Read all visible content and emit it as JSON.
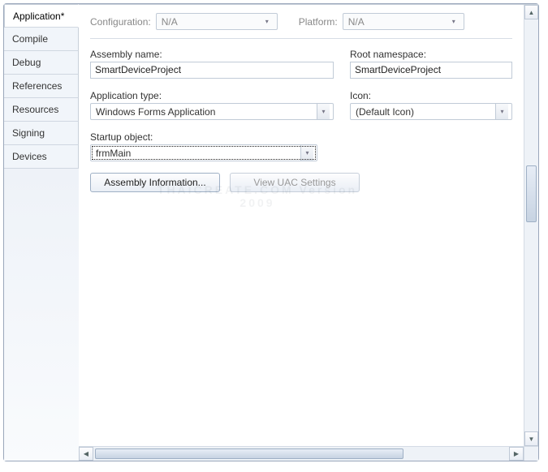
{
  "tabs": [
    "Application*",
    "Compile",
    "Debug",
    "References",
    "Resources",
    "Signing",
    "Devices"
  ],
  "active_tab_index": 0,
  "toprow": {
    "configuration_label": "Configuration:",
    "configuration_value": "N/A",
    "platform_label": "Platform:",
    "platform_value": "N/A"
  },
  "assembly": {
    "label": "Assembly name:",
    "value": "SmartDeviceProject"
  },
  "namespace": {
    "label": "Root namespace:",
    "value": "SmartDeviceProject"
  },
  "apptype": {
    "label": "Application type:",
    "value": "Windows Forms Application"
  },
  "icon": {
    "label": "Icon:",
    "value": "(Default Icon)"
  },
  "startup": {
    "label": "Startup object:",
    "value": "frmMain"
  },
  "buttons": {
    "assembly_info": "Assembly Information...",
    "uac": "View UAC Settings"
  },
  "watermark": "THAICREATE.COM\nVersion 2009"
}
